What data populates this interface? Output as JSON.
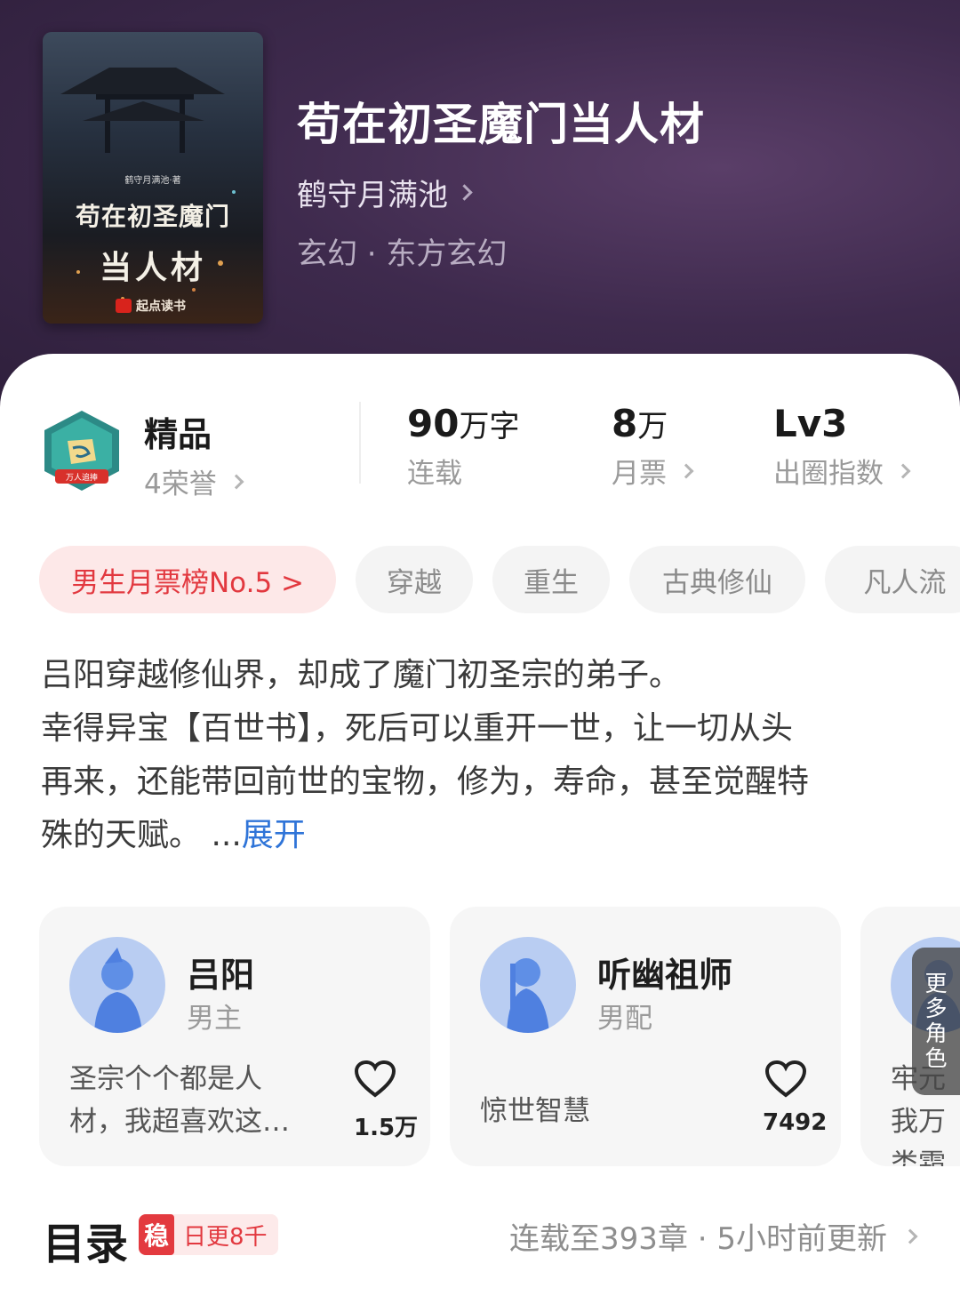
{
  "book": {
    "title": "苟在初圣魔门当人材",
    "author": "鹤守月满池",
    "genre": "玄幻 · 东方玄幻",
    "cover": {
      "author_line": "鹤守月满池·著",
      "title_line1": "苟在初圣魔门",
      "title_line2": "当人材",
      "publisher": "起点读书"
    }
  },
  "stats": {
    "honor": {
      "label": "精品",
      "sub": "4荣誉",
      "badge_text": "万人追捧"
    },
    "words": {
      "num": "90",
      "unit": "万字",
      "sub": "连载"
    },
    "tickets": {
      "num": "8",
      "unit": "万",
      "sub": "月票"
    },
    "index": {
      "num": "Lv3",
      "sub": "出圈指数"
    }
  },
  "tags": [
    "男生月票榜No.5 >",
    "穿越",
    "重生",
    "古典修仙",
    "凡人流"
  ],
  "synopsis": {
    "lines": [
      "吕阳穿越修仙界，却成了魔门初圣宗的弟子。",
      "幸得异宝【百世书】，死后可以重开一世，让一切从头",
      "再来，还能带回前世的宝物，修为，寿命，甚至觉醒特",
      "殊的天赋。 ..."
    ],
    "expand": "展开"
  },
  "roles": [
    {
      "name": "吕阳",
      "type": "男主",
      "desc": "圣宗个个都是人材，我超喜欢这…",
      "likes": "1.5万"
    },
    {
      "name": "听幽祖师",
      "type": "男配",
      "desc": "惊世智慧",
      "likes": "7492"
    },
    {
      "desc": "牢元我万类霜"
    }
  ],
  "more_roles": [
    "更",
    "多",
    "角",
    "色"
  ],
  "toc": {
    "title": "目录",
    "stable": "稳",
    "daily": "日更8千",
    "status": "连载至393章 · 5小时前更新"
  },
  "colors": {
    "accent_red": "#e2383f",
    "link_blue": "#2f74d8",
    "hero_bg": "#3e2a4d"
  }
}
